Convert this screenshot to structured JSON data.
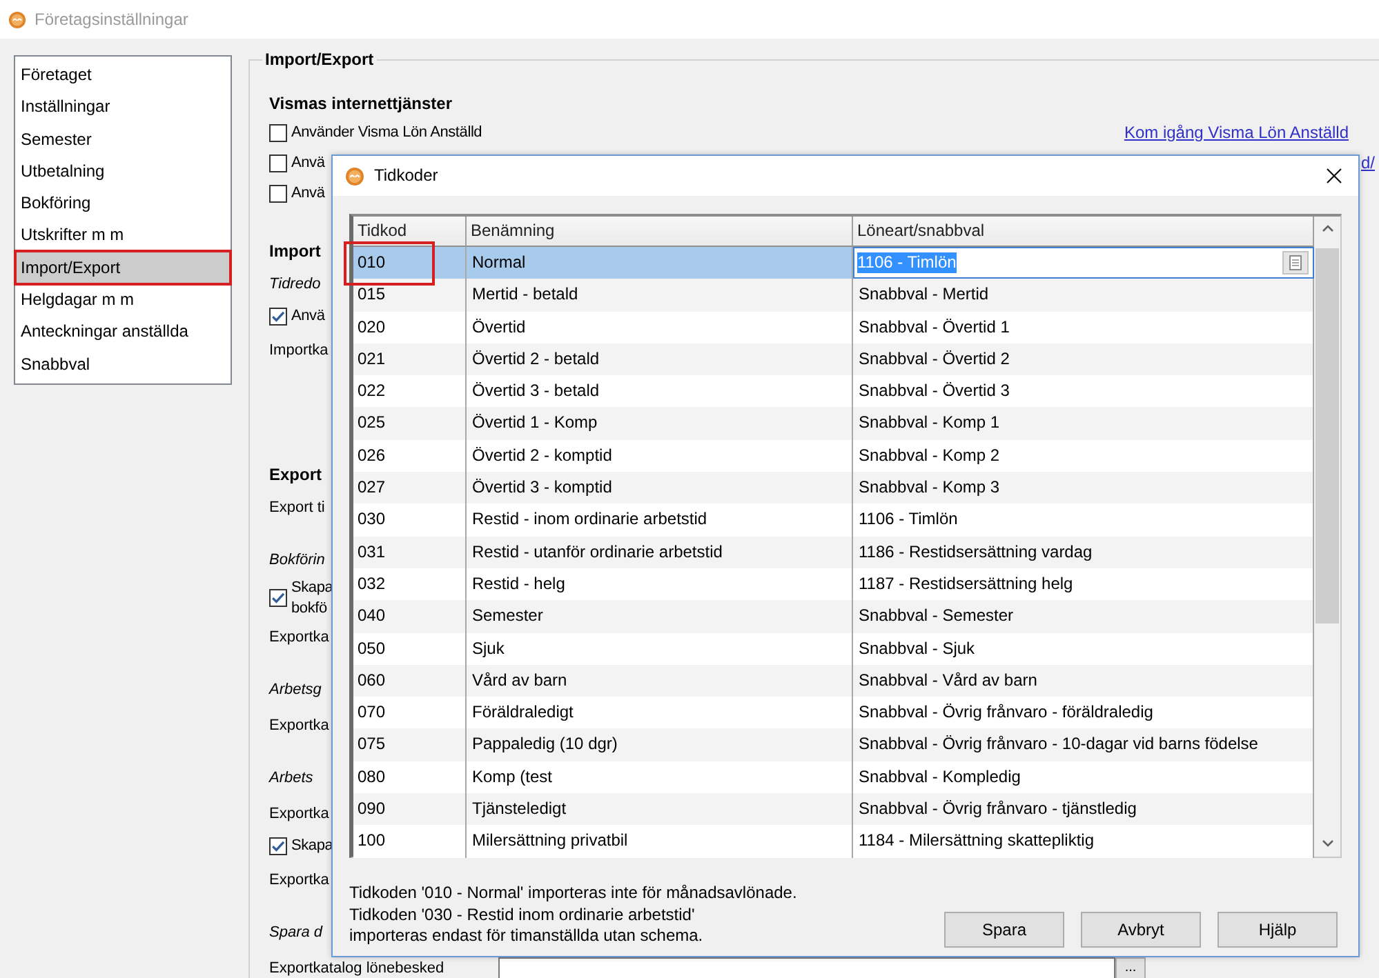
{
  "window": {
    "title": "Företagsinställningar"
  },
  "sidebar": {
    "items": [
      {
        "label": "Företaget",
        "selected": false,
        "annotated": false
      },
      {
        "label": "Inställningar",
        "selected": false,
        "annotated": false
      },
      {
        "label": "Semester",
        "selected": false,
        "annotated": false
      },
      {
        "label": "Utbetalning",
        "selected": false,
        "annotated": false
      },
      {
        "label": "Bokföring",
        "selected": false,
        "annotated": false
      },
      {
        "label": "Utskrifter m m",
        "selected": false,
        "annotated": false
      },
      {
        "label": "Import/Export",
        "selected": true,
        "annotated": true
      },
      {
        "label": "Helgdagar m m",
        "selected": false,
        "annotated": false
      },
      {
        "label": "Anteckningar anställda",
        "selected": false,
        "annotated": false
      },
      {
        "label": "Snabbval",
        "selected": false,
        "annotated": false
      }
    ]
  },
  "settings": {
    "title": "Import/Export",
    "sections": [
      {
        "heading": "Vismas internettjänster",
        "items": [
          {
            "kind": "checkbox",
            "label": "Använder Visma Lön Anställd",
            "checked": false,
            "link": "Kom igång Visma Lön Anställd"
          },
          {
            "kind": "checkbox",
            "label": "Anvä",
            "checked": false,
            "link": "d/"
          },
          {
            "kind": "checkbox",
            "label": "Anvä",
            "checked": false
          }
        ]
      },
      {
        "heading": "Import",
        "items": [
          {
            "kind": "caption",
            "label": "Tidredo"
          },
          {
            "kind": "checkbox",
            "label": "Anvä",
            "checked": true
          },
          {
            "kind": "label",
            "label": "Importka"
          }
        ]
      },
      {
        "heading": "Export",
        "items": [
          {
            "kind": "label",
            "label": "Export ti"
          },
          {
            "kind": "caption",
            "label": "Bokförin"
          },
          {
            "kind": "checkbox",
            "label": "Skapa\nbokfö",
            "checked": true
          },
          {
            "kind": "label",
            "label": "Exportka"
          },
          {
            "kind": "caption",
            "label": "Arbetsg"
          },
          {
            "kind": "label",
            "label": "Exportka"
          },
          {
            "kind": "caption",
            "label": "Arbets"
          },
          {
            "kind": "label",
            "label": "Exportka"
          },
          {
            "kind": "checkbox",
            "label": "Skapa",
            "checked": true
          },
          {
            "kind": "label",
            "label": "Exportka"
          },
          {
            "kind": "caption",
            "label": "Spara d"
          },
          {
            "kind": "path",
            "label": "Exportkatalog lönebesked",
            "button": "..."
          }
        ]
      }
    ]
  },
  "dialog": {
    "title": "Tidkoder",
    "table": {
      "columns": [
        "Tidkod",
        "Benämning",
        "Löneart/snabbval"
      ],
      "rows": [
        {
          "code": "010",
          "name": "Normal",
          "pay_type": "1106 - Timlön",
          "selected": true,
          "editing": true,
          "annotated": true
        },
        {
          "code": "015",
          "name": "Mertid - betald",
          "pay_type": "Snabbval - Mertid",
          "selected": false,
          "editing": false,
          "annotated": false
        },
        {
          "code": "020",
          "name": "Övertid",
          "pay_type": "Snabbval - Övertid 1",
          "selected": false,
          "editing": false,
          "annotated": false
        },
        {
          "code": "021",
          "name": "Övertid 2 - betald",
          "pay_type": "Snabbval - Övertid 2",
          "selected": false,
          "editing": false,
          "annotated": false
        },
        {
          "code": "022",
          "name": "Övertid 3 - betald",
          "pay_type": "Snabbval - Övertid 3",
          "selected": false,
          "editing": false,
          "annotated": false
        },
        {
          "code": "025",
          "name": "Övertid 1 - Komp",
          "pay_type": "Snabbval - Komp 1",
          "selected": false,
          "editing": false,
          "annotated": false
        },
        {
          "code": "026",
          "name": "Övertid 2 - komptid",
          "pay_type": "Snabbval - Komp 2",
          "selected": false,
          "editing": false,
          "annotated": false
        },
        {
          "code": "027",
          "name": "Övertid 3 - komptid",
          "pay_type": "Snabbval - Komp 3",
          "selected": false,
          "editing": false,
          "annotated": false
        },
        {
          "code": "030",
          "name": "Restid - inom ordinarie arbetstid",
          "pay_type": "1106 - Timlön",
          "selected": false,
          "editing": false,
          "annotated": false
        },
        {
          "code": "031",
          "name": "Restid - utanför ordinarie arbetstid",
          "pay_type": "1186 - Restidsersättning vardag",
          "selected": false,
          "editing": false,
          "annotated": false
        },
        {
          "code": "032",
          "name": "Restid - helg",
          "pay_type": "1187 - Restidsersättning helg",
          "selected": false,
          "editing": false,
          "annotated": false
        },
        {
          "code": "040",
          "name": "Semester",
          "pay_type": "Snabbval - Semester",
          "selected": false,
          "editing": false,
          "annotated": false
        },
        {
          "code": "050",
          "name": "Sjuk",
          "pay_type": "Snabbval - Sjuk",
          "selected": false,
          "editing": false,
          "annotated": false
        },
        {
          "code": "060",
          "name": "Vård av barn",
          "pay_type": "Snabbval - Vård av barn",
          "selected": false,
          "editing": false,
          "annotated": false
        },
        {
          "code": "070",
          "name": "Föräldraledigt",
          "pay_type": "Snabbval - Övrig frånvaro - föräldraledig",
          "selected": false,
          "editing": false,
          "annotated": false
        },
        {
          "code": "075",
          "name": "Pappaledig (10 dgr)",
          "pay_type": "Snabbval - Övrig frånvaro - 10-dagar vid barns födelse",
          "selected": false,
          "editing": false,
          "annotated": false
        },
        {
          "code": "080",
          "name": "Komp (test",
          "pay_type": "Snabbval - Kompledig",
          "selected": false,
          "editing": false,
          "annotated": false
        },
        {
          "code": "090",
          "name": "Tjänsteledigt",
          "pay_type": "Snabbval - Övrig frånvaro - tjänstledig",
          "selected": false,
          "editing": false,
          "annotated": false
        },
        {
          "code": "100",
          "name": "Milersättning privatbil",
          "pay_type": "1184 - Milersättning skattepliktig",
          "selected": false,
          "editing": false,
          "annotated": false
        }
      ]
    },
    "notes": [
      "Tidkoden '010 - Normal' importeras inte för månadsavlönade.",
      "Tidkoden '030 - Restid inom ordinarie arbetstid'\nimporteras endast för timanställda utan schema."
    ],
    "buttons": [
      "Spara",
      "Avbryt",
      "Hjälp"
    ]
  }
}
